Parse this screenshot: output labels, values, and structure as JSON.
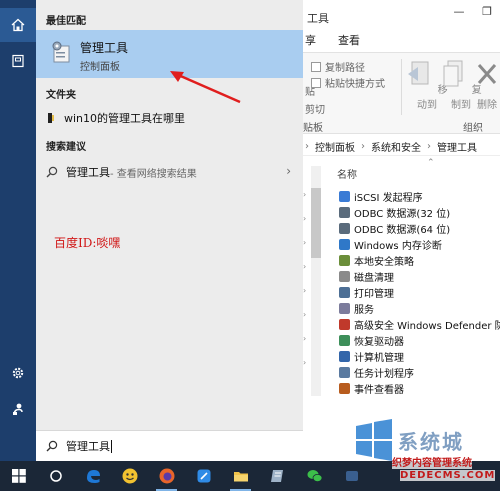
{
  "explorer": {
    "title": "工具",
    "tabs": [
      "享",
      "查看"
    ],
    "ribbon": {
      "copy_path": "复制路径",
      "paste_shortcut": "粘贴快捷方式",
      "paste_cut_1": "贴",
      "paste_cut_2": "剪切",
      "clipboard_group": "贴板",
      "move_to": "移动到",
      "copy_to": "复制到",
      "delete": "删除",
      "organize_group": "组织"
    },
    "address": [
      "控制面板",
      "系统和安全",
      "管理工具"
    ],
    "column_header": "名称",
    "items": [
      {
        "label": "iSCSI 发起程序",
        "color": "#3a7bd5"
      },
      {
        "label": "ODBC 数据源(32 位)",
        "color": "#5a6b7c"
      },
      {
        "label": "ODBC 数据源(64 位)",
        "color": "#5a6b7c"
      },
      {
        "label": "Windows 内存诊断",
        "color": "#2f78c8"
      },
      {
        "label": "本地安全策略",
        "color": "#6b8e3a"
      },
      {
        "label": "磁盘清理",
        "color": "#8a8a8a"
      },
      {
        "label": "打印管理",
        "color": "#4d6f95"
      },
      {
        "label": "服务",
        "color": "#7c7c9c"
      },
      {
        "label": "高级安全 Windows Defender 防火墙",
        "color": "#c0392b"
      },
      {
        "label": "恢复驱动器",
        "color": "#3d8f5a"
      },
      {
        "label": "计算机管理",
        "color": "#3366aa"
      },
      {
        "label": "任务计划程序",
        "color": "#5a7aa0"
      },
      {
        "label": "事件查看器",
        "color": "#b85c1e"
      }
    ]
  },
  "panel": {
    "best_match_header": "最佳匹配",
    "best_match": {
      "title": "管理工具",
      "subtitle": "控制面板"
    },
    "folders_header": "文件夹",
    "folder_item": "win10的管理工具在哪里",
    "suggestions_header": "搜索建议",
    "suggestion": {
      "label": "管理工具",
      "suffix": " - 查看网络搜索结果"
    },
    "annotation": "百度ID:啖嘿"
  },
  "searchbar": {
    "value": "管理工具"
  },
  "logo": {
    "big": "系统城",
    "small": "织梦内容管理系统",
    "url": "DEDECMS.COM"
  },
  "colors": {
    "rail": "#1d3e6c",
    "best_match_highlight": "#a9cdf0",
    "taskbar": "#1b2737",
    "arrow": "#e01e1e"
  }
}
